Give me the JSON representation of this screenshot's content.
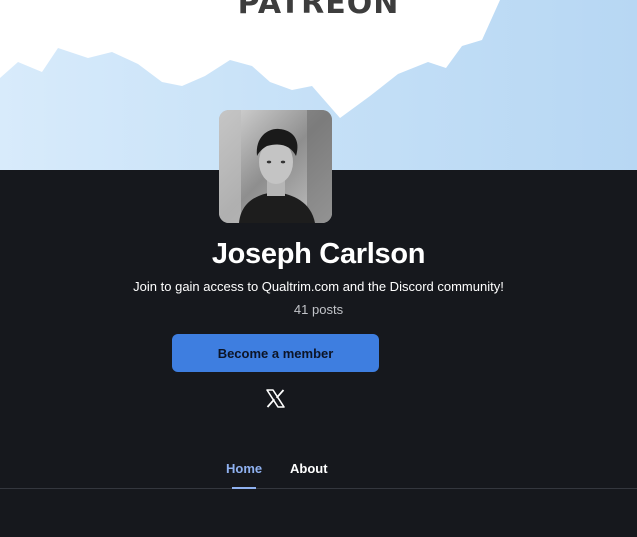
{
  "banner": {
    "brand_text": "PATREON"
  },
  "creator": {
    "name": "Joseph Carlson",
    "tagline": "Join to gain access to Qualtrim.com and the Discord community!",
    "posts": "41 posts"
  },
  "actions": {
    "member_button": "Become a member",
    "social_icon": "x-twitter-icon"
  },
  "tabs": [
    {
      "label": "Home",
      "active": true
    },
    {
      "label": "About",
      "active": false
    }
  ],
  "colors": {
    "background": "#16181d",
    "accent_button": "#3e7ee0",
    "active_tab": "#8fb1f0",
    "banner_sky": "#cfe5f8"
  }
}
